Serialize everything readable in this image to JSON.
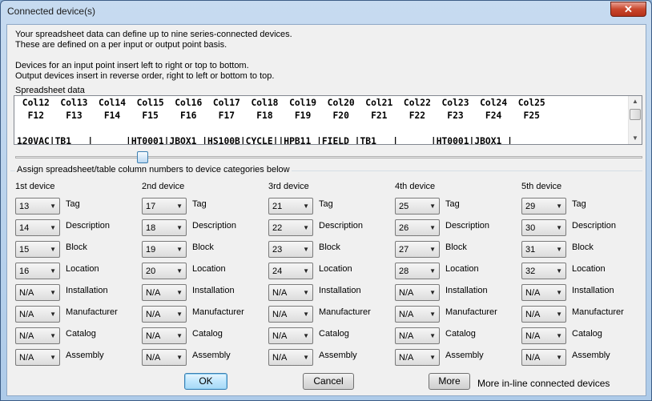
{
  "window": {
    "title": "Connected device(s)",
    "close_glyph": "✕"
  },
  "intro": {
    "line1": "Your spreadsheet data can define up to nine series-connected devices.",
    "line2": "These are defined on a per input or output point basis.",
    "line3": "Devices for an input point insert left to right or top to bottom.",
    "line4": "Output devices insert in reverse order, right to left or bottom to top."
  },
  "spreadsheet": {
    "label": "Spreadsheet data",
    "row1": " Col12  Col13  Col14  Col15  Col16  Col17  Col18  Col19  Col20  Col21  Col22  Col23  Col24  Col25",
    "row2": "  F12    F13    F14    F15    F16    F17    F18    F19    F20    F21    F22    F23    F24    F25",
    "row3": "",
    "row4": "120VAC|TB1   |      |HT0001|JBOX1 |HS100B|CYCLE||HPB11 |FIELD |TB1   |      |HT0001|JBOX1 |",
    "scroll_up": "▲",
    "scroll_down": "▼"
  },
  "group_label": "Assign spreadsheet/table column numbers to device categories below",
  "field_labels": [
    "Tag",
    "Description",
    "Block",
    "Location",
    "Installation",
    "Manufacturer",
    "Catalog",
    "Assembly"
  ],
  "devices": [
    {
      "title": "1st device",
      "values": [
        "13",
        "14",
        "15",
        "16",
        "N/A",
        "N/A",
        "N/A",
        "N/A"
      ]
    },
    {
      "title": "2nd device",
      "values": [
        "17",
        "18",
        "19",
        "20",
        "N/A",
        "N/A",
        "N/A",
        "N/A"
      ]
    },
    {
      "title": "3rd device",
      "values": [
        "21",
        "22",
        "23",
        "24",
        "N/A",
        "N/A",
        "N/A",
        "N/A"
      ]
    },
    {
      "title": "4th device",
      "values": [
        "25",
        "26",
        "27",
        "28",
        "N/A",
        "N/A",
        "N/A",
        "N/A"
      ]
    },
    {
      "title": "5th device",
      "values": [
        "29",
        "30",
        "31",
        "32",
        "N/A",
        "N/A",
        "N/A",
        "N/A"
      ]
    }
  ],
  "buttons": {
    "ok": "OK",
    "cancel": "Cancel",
    "more": "More",
    "more_text": "More in-line connected devices"
  }
}
